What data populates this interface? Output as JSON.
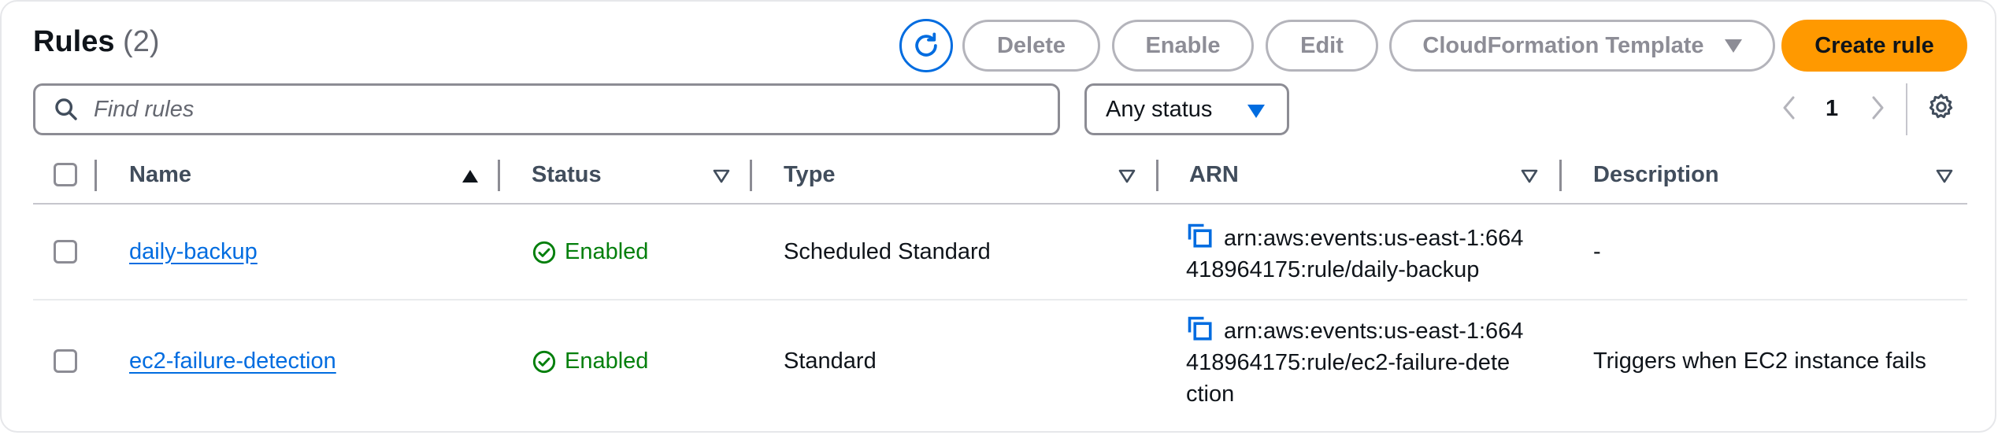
{
  "header": {
    "title": "Rules",
    "count": "(2)",
    "buttons": {
      "delete": "Delete",
      "enable": "Enable",
      "edit": "Edit",
      "cloudformation": "CloudFormation Template",
      "create": "Create rule"
    }
  },
  "filters": {
    "search_placeholder": "Find rules",
    "status_select": "Any status"
  },
  "pagination": {
    "current_page": "1"
  },
  "table": {
    "columns": [
      "Name",
      "Status",
      "Type",
      "ARN",
      "Description"
    ],
    "rows": [
      {
        "name": "daily-backup",
        "status": "Enabled",
        "type": "Scheduled Standard",
        "arn_lines": [
          "arn:aws:events:us-east-1:664",
          "418964175:rule/daily-backup"
        ],
        "description": "-"
      },
      {
        "name": "ec2-failure-detection",
        "status": "Enabled",
        "type": "Standard",
        "arn_lines": [
          "arn:aws:events:us-east-1:664",
          "418964175:rule/ec2-failure-dete",
          "ction"
        ],
        "description": "Triggers when EC2 instance fails"
      }
    ]
  },
  "colors": {
    "primary_button": "#ff9900",
    "link": "#006ce0",
    "enabled_status": "#037f0c",
    "disabled_button_text": "#8d8d96"
  },
  "icons": [
    "refresh-icon",
    "caret-down-icon",
    "search-icon",
    "chevron-left-icon",
    "chevron-right-icon",
    "settings-gear-icon",
    "sort-ascending-icon",
    "sort-icon",
    "status-check-icon",
    "copy-icon"
  ]
}
